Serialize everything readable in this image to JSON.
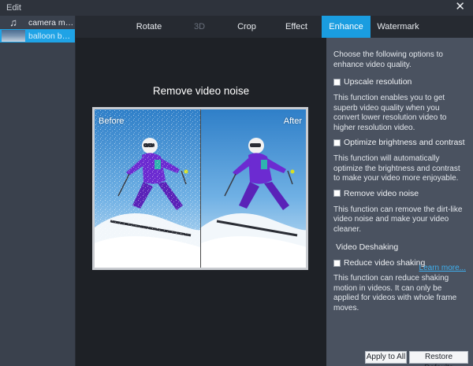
{
  "window": {
    "title": "Edit"
  },
  "files": [
    {
      "name": "camera man-...",
      "icon": "music-note-icon"
    },
    {
      "name": "balloon beaut...",
      "icon": "thumbnail-image"
    }
  ],
  "tabs": [
    {
      "label": "Rotate",
      "state": "normal"
    },
    {
      "label": "3D",
      "state": "disabled"
    },
    {
      "label": "Crop",
      "state": "normal"
    },
    {
      "label": "Effect",
      "state": "normal"
    },
    {
      "label": "Enhance",
      "state": "active"
    },
    {
      "label": "Watermark",
      "state": "normal"
    }
  ],
  "preview": {
    "heading": "Remove video noise",
    "before_label": "Before",
    "after_label": "After"
  },
  "panel": {
    "intro": "Choose the following options to enhance video quality.",
    "options": [
      {
        "label": "Upscale resolution",
        "checked": false,
        "desc": "This function enables you to get superb video quality when you convert lower resolution video to higher resolution video."
      },
      {
        "label": "Optimize brightness and contrast",
        "checked": false,
        "desc": "This function will automatically optimize the brightness and contrast to make your video more enjoyable."
      },
      {
        "label": "Remove video noise",
        "checked": false,
        "desc": "This function can remove the dirt-like video noise and make your video cleaner."
      }
    ],
    "deshake_section": "Video Deshaking",
    "deshake": {
      "label": "Reduce video shaking",
      "checked": false,
      "desc": "This function can reduce shaking motion in videos. It can only be applied for videos with whole frame moves."
    },
    "learn_more": "Learn more..."
  },
  "buttons": {
    "apply_all": "Apply to All",
    "restore": "Restore Defaults"
  },
  "colors": {
    "accent": "#1a9de0",
    "tabbar": "#262a31",
    "panel": "#4a5260",
    "preview_bg": "#1e2126",
    "link": "#3fb1f0"
  }
}
